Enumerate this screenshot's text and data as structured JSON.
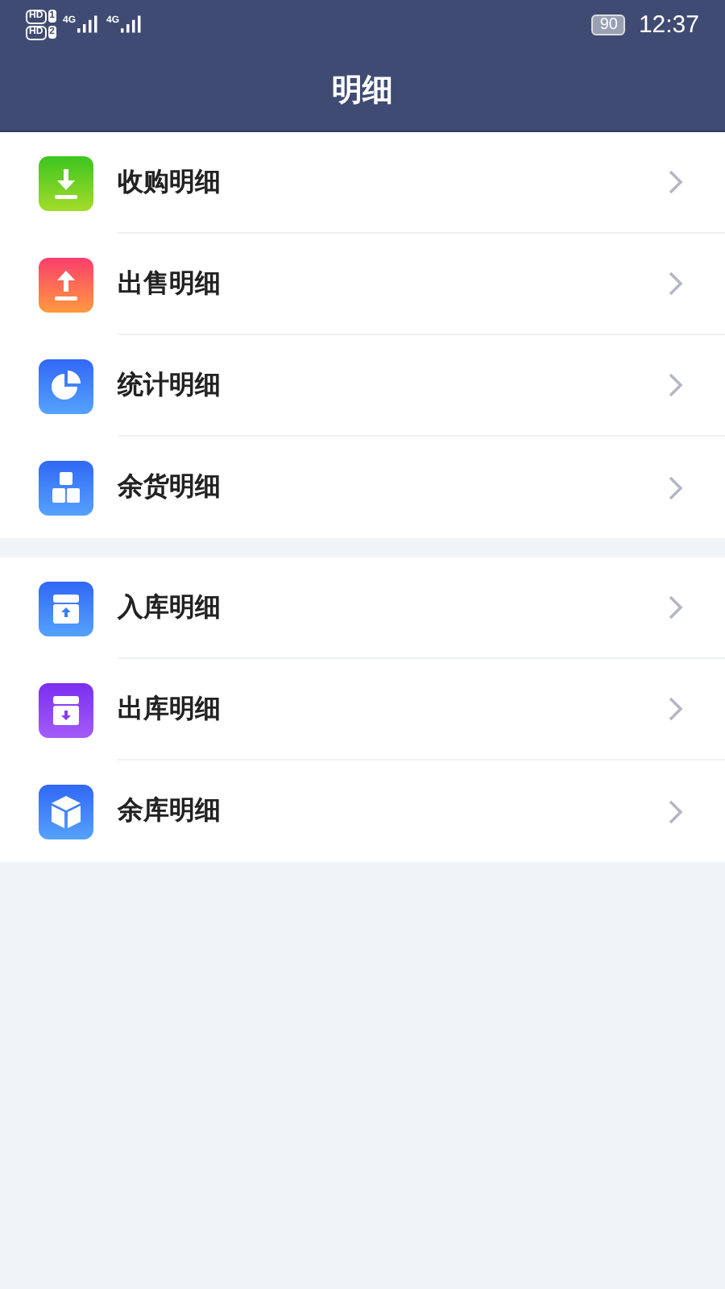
{
  "status_bar": {
    "sims": [
      {
        "badge": "HD",
        "slot": "1"
      },
      {
        "badge": "HD",
        "slot": "2"
      }
    ],
    "networks": [
      "4G",
      "4G"
    ],
    "battery": "90",
    "time": "12:37"
  },
  "title": "明细",
  "groups": [
    {
      "items": [
        {
          "label": "收购明细",
          "kind": "download"
        },
        {
          "label": "出售明细",
          "kind": "upload"
        },
        {
          "label": "统计明细",
          "kind": "pie"
        },
        {
          "label": "余货明细",
          "kind": "boxes"
        }
      ]
    },
    {
      "items": [
        {
          "label": "入库明细",
          "kind": "inbox-in"
        },
        {
          "label": "出库明细",
          "kind": "inbox-out"
        },
        {
          "label": "余库明细",
          "kind": "cube"
        }
      ]
    }
  ]
}
